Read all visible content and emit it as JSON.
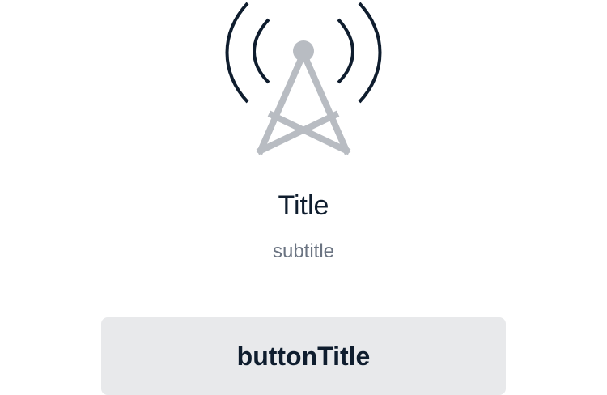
{
  "empty_state": {
    "icon": "radio-tower-signal-icon",
    "title": "Title",
    "subtitle": "subtitle",
    "button_label": "buttonTitle"
  },
  "colors": {
    "tower": "#b8bcc2",
    "waves": "#0f1d2e",
    "title": "#0f1d2e",
    "subtitle": "#6b7482",
    "button_bg": "#e8e9eb",
    "button_text": "#0f1d2e"
  }
}
